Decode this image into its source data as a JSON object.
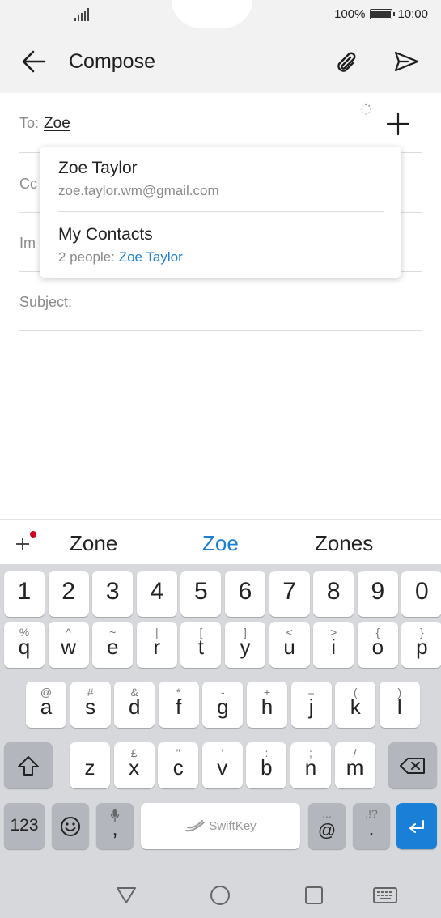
{
  "status": {
    "battery": "100%",
    "time": "10:00"
  },
  "app_bar": {
    "title": "Compose"
  },
  "fields": {
    "to_label": "To:",
    "to_value": "Zoe",
    "cc_label": "Cc",
    "imp_label": "Im",
    "subject_label": "Subject:"
  },
  "suggestions": [
    {
      "name": "Zoe Taylor",
      "detail": "zoe.taylor.wm@gmail.com"
    },
    {
      "name": "My Contacts",
      "detail_prefix": "2 people:",
      "detail_link": "Zoe Taylor"
    }
  ],
  "predictions": [
    "Zone",
    "Zoe",
    "Zones"
  ],
  "keyboard": {
    "numbers": [
      "1",
      "2",
      "3",
      "4",
      "5",
      "6",
      "7",
      "8",
      "9",
      "0"
    ],
    "row1": [
      {
        "key": "q",
        "hint": "%"
      },
      {
        "key": "w",
        "hint": "^"
      },
      {
        "key": "e",
        "hint": "~"
      },
      {
        "key": "r",
        "hint": "|"
      },
      {
        "key": "t",
        "hint": "["
      },
      {
        "key": "y",
        "hint": "]"
      },
      {
        "key": "u",
        "hint": "<"
      },
      {
        "key": "i",
        "hint": ">"
      },
      {
        "key": "o",
        "hint": "{"
      },
      {
        "key": "p",
        "hint": "}"
      }
    ],
    "row2": [
      {
        "key": "a",
        "hint": "@"
      },
      {
        "key": "s",
        "hint": "#"
      },
      {
        "key": "d",
        "hint": "&"
      },
      {
        "key": "f",
        "hint": "*"
      },
      {
        "key": "g",
        "hint": "-"
      },
      {
        "key": "h",
        "hint": "+"
      },
      {
        "key": "j",
        "hint": "="
      },
      {
        "key": "k",
        "hint": "("
      },
      {
        "key": "l",
        "hint": ")"
      }
    ],
    "row3": [
      {
        "key": "z",
        "hint": "_"
      },
      {
        "key": "x",
        "hint": "£"
      },
      {
        "key": "c",
        "hint": "\""
      },
      {
        "key": "v",
        "hint": "'"
      },
      {
        "key": "b",
        "hint": ":"
      },
      {
        "key": "n",
        "hint": ";"
      },
      {
        "key": "m",
        "hint": "/"
      }
    ],
    "sym_label": "123",
    "comma": ",",
    "space_label": "SwiftKey",
    "at_key": "@",
    "at_hint": "...",
    "period_key": ".",
    "period_hint": ",!?"
  },
  "colors": {
    "accent": "#1a7fd6",
    "notification_dot": "#d0021b"
  }
}
